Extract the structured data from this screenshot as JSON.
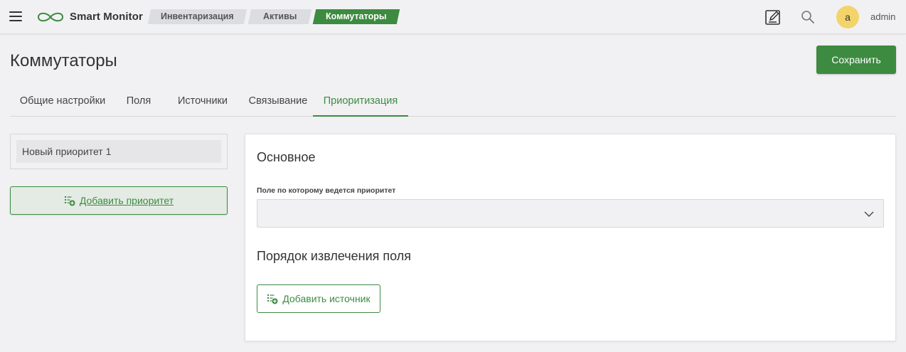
{
  "app": {
    "brand": "Smart Monitor"
  },
  "breadcrumbs": [
    "Инвентаризация",
    "Активы",
    "Коммутаторы"
  ],
  "user": {
    "avatar_letter": "a",
    "name": "admin"
  },
  "page": {
    "title": "Коммутаторы",
    "save_label": "Сохранить"
  },
  "tabs": [
    {
      "label": "Общие настройки"
    },
    {
      "label": "Поля"
    },
    {
      "label": "Источники"
    },
    {
      "label": "Связывание"
    },
    {
      "label": "Приоритизация",
      "active": true
    }
  ],
  "priorities": {
    "items": [
      "Новый приоритет 1"
    ],
    "add_label": "Добавить приоритет"
  },
  "panel": {
    "section_main": "Основное",
    "field_label": "Поле по которому ведется приоритет",
    "field_value": "",
    "section_order": "Порядок извлечения поля",
    "add_source_label": "Добавить источник"
  },
  "colors": {
    "accent": "#3d8b40",
    "avatar": "#f3d46a",
    "background": "#f1f1f3"
  },
  "icons": [
    "menu-icon",
    "infinity-logo-icon",
    "edit-icon",
    "search-icon",
    "list-add-icon",
    "chevron-down-icon"
  ]
}
